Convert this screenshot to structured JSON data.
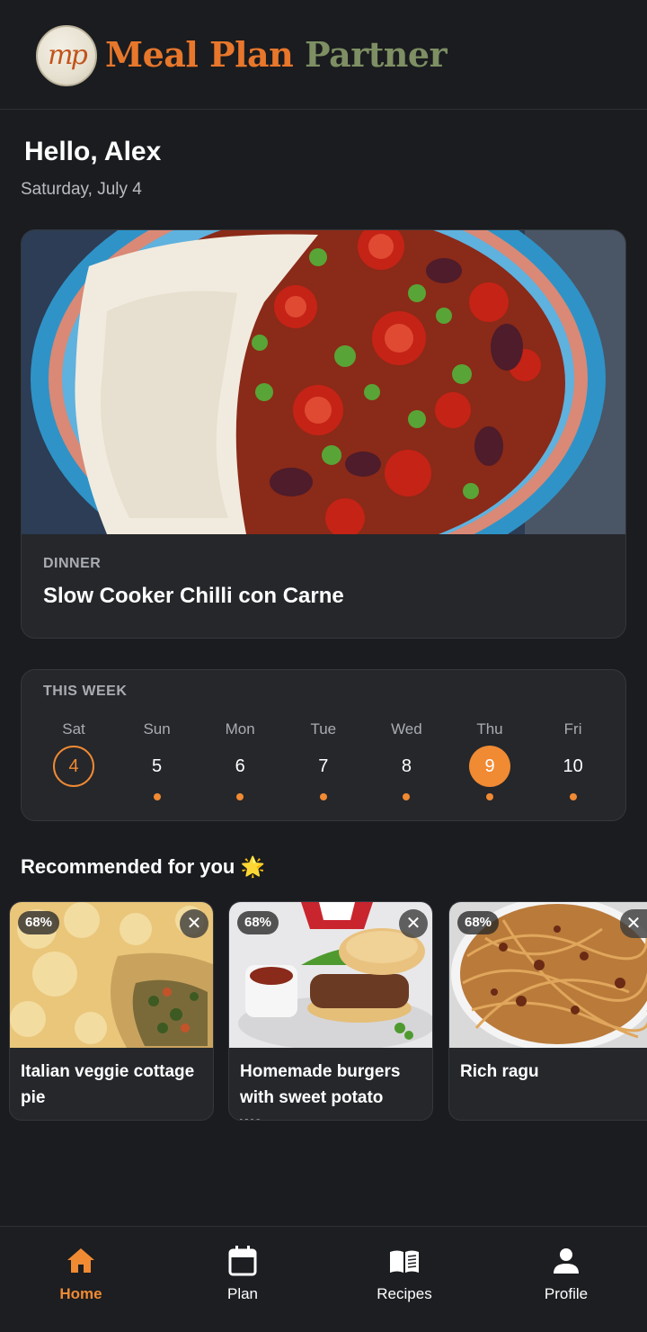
{
  "app": {
    "brand_part1": "Meal Plan",
    "brand_part2": "Partner",
    "logo_text": "mp"
  },
  "greeting": "Hello, Alex",
  "date": "Saturday, July 4",
  "hero": {
    "meal": "DINNER",
    "title": "Slow Cooker Chilli con Carne"
  },
  "week": {
    "title": "THIS WEEK",
    "days": [
      {
        "name": "Sat",
        "num": "4",
        "state": "today",
        "has_meal": false
      },
      {
        "name": "Sun",
        "num": "5",
        "state": "normal",
        "has_meal": true
      },
      {
        "name": "Mon",
        "num": "6",
        "state": "normal",
        "has_meal": true
      },
      {
        "name": "Tue",
        "num": "7",
        "state": "normal",
        "has_meal": true
      },
      {
        "name": "Wed",
        "num": "8",
        "state": "normal",
        "has_meal": true
      },
      {
        "name": "Thu",
        "num": "9",
        "state": "selected",
        "has_meal": true
      },
      {
        "name": "Fri",
        "num": "10",
        "state": "normal",
        "has_meal": true
      }
    ]
  },
  "recommended": {
    "title": "Recommended for you 🌟",
    "items": [
      {
        "match": "68%",
        "name": "Italian veggie cottage pie"
      },
      {
        "match": "68%",
        "name": "Homemade burgers with sweet potato we..."
      },
      {
        "match": "68%",
        "name": "Rich ragu"
      }
    ],
    "close_icon": "close-icon"
  },
  "nav": [
    {
      "label": "Home",
      "icon": "home-icon",
      "active": true
    },
    {
      "label": "Plan",
      "icon": "calendar-icon",
      "active": false
    },
    {
      "label": "Recipes",
      "icon": "book-icon",
      "active": false
    },
    {
      "label": "Profile",
      "icon": "person-icon",
      "active": false
    }
  ],
  "colors": {
    "accent": "#f08a33",
    "background": "#1a1c1f",
    "card": "#25272b",
    "brand_orange": "#e8772b",
    "brand_green": "#7e8f63"
  }
}
